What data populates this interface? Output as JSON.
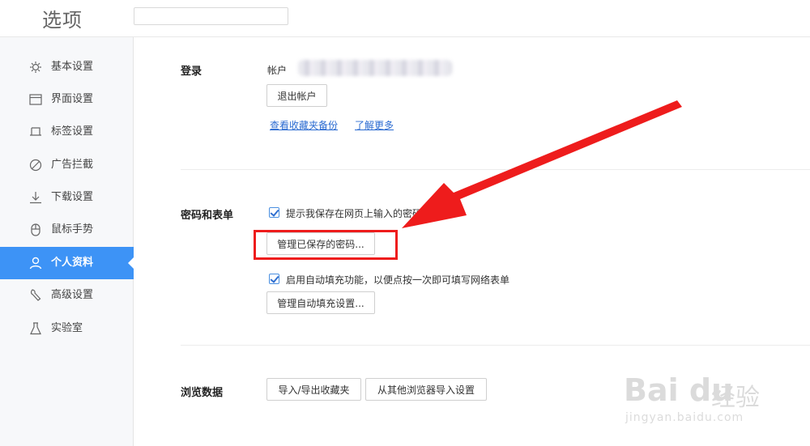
{
  "header": {
    "title": "选项",
    "search_value": ""
  },
  "sidebar": {
    "items": [
      {
        "label": "基本设置",
        "icon": "gear-icon"
      },
      {
        "label": "界面设置",
        "icon": "window-icon"
      },
      {
        "label": "标签设置",
        "icon": "tab-icon"
      },
      {
        "label": "广告拦截",
        "icon": "block-icon"
      },
      {
        "label": "下载设置",
        "icon": "download-icon"
      },
      {
        "label": "鼠标手势",
        "icon": "mouse-icon"
      },
      {
        "label": "个人资料",
        "icon": "user-icon",
        "active": true
      },
      {
        "label": "高级设置",
        "icon": "wrench-icon"
      },
      {
        "label": "实验室",
        "icon": "flask-icon"
      }
    ]
  },
  "login": {
    "title": "登录",
    "account_label": "帐户",
    "logout_label": "退出帐户",
    "view_backup_link": "查看收藏夹备份",
    "learn_more_link": "了解更多"
  },
  "passwords": {
    "title": "密码和表单",
    "save_prompt_label": "提示我保存在网页上输入的密码",
    "manage_passwords_label": "管理已保存的密码...",
    "autofill_label": "启用自动填充功能，以便点按一次即可填写网络表单",
    "manage_autofill_label": "管理自动填充设置..."
  },
  "browsing": {
    "title": "浏览数据",
    "import_export_label": "导入/导出收藏夹",
    "import_other_label": "从其他浏览器导入设置"
  },
  "colors": {
    "accent": "#3d93f6",
    "annotation": "#ee1c1c",
    "link": "#2b6bd1"
  },
  "watermark": {
    "logo": "Bai du",
    "cn": "经验",
    "url": "jingyan.baidu.com"
  }
}
